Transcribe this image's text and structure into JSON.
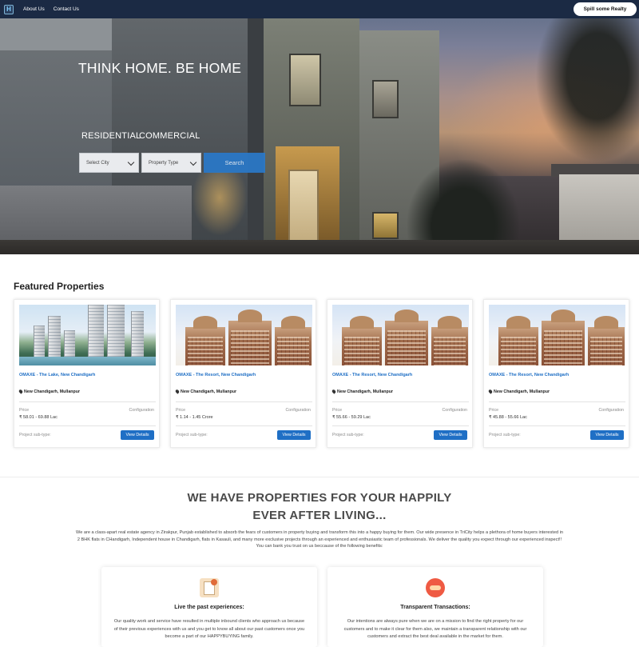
{
  "nav": {
    "logo": "H",
    "links": [
      "About Us",
      "Contact Us"
    ],
    "cta": "Spill some Realty"
  },
  "hero": {
    "title": "THINK HOME. BE HOME",
    "tabs": [
      "RESIDENTIAL",
      "COMMERCIAL"
    ],
    "select_city": "Select City",
    "property_type": "Property Type",
    "search_label": "Search"
  },
  "featured": {
    "title": "Featured Properties",
    "price_label": "Price",
    "config_label": "Configuration",
    "subtype_label": "Project sub-type:",
    "button_label": "View Details",
    "cards": [
      {
        "name": "OMAXE - The Lake, New Chandigarh",
        "location": "New Chandigarh, Mullanpur",
        "price": "₹ 58.01 - 69.88 Lac"
      },
      {
        "name": "OMAXE - The Resort, New Chandigarh",
        "location": "New Chandigarh, Mullanpur",
        "price": "₹ 1.14 - 1.45 Crore"
      },
      {
        "name": "OMAXE - The Resort, New Chandigarh",
        "location": "New Chandigarh, Mullanpur",
        "price": "₹ 55.66 - 59.29 Lac"
      },
      {
        "name": "OMAXE - The Resort, New Chandigarh",
        "location": "New Chandigarh, Mullanpur",
        "price": "₹ 45.88 - 55.66 Lac"
      }
    ]
  },
  "about": {
    "title_line1": "WE HAVE PROPERTIES FOR YOUR HAPPILY",
    "title_line2": "EVER AFTER LIVING...",
    "text": "We are a class-apart real estate agency in Zirakpur, Punjab established to absorb the fears of customers in property buying and transform this into a happy buying for them. Our wide presence in TriCity helps a plethora of home buyers interested in 2 BHK flats in CHandigarh, Independent house in Chandigarh, flats in Kasauli, and many more exclusive projects through an experienced and enthusiastic team of professionals. We deliver the quality you expect through our experienced inspect!! You can bank you trust on us beccause of the following benefits:",
    "benefits": [
      {
        "icon": "certificate-icon",
        "title": "Live the past experiences:",
        "text": "Our quality work and service have resulted in multiple inbound clients who approach us because of their previous experiences with us and you get to know all about our past customers once you become a part of our HAPPYBUYING family."
      },
      {
        "icon": "handshake-icon",
        "title": "Transparent Transactions:",
        "text": "Our intentions are always pure when we are on a mission to find the right property for our customers and to make it clear for them also, we maintain a transparent relationship with our customers and extract the best deal available in the market for them."
      }
    ]
  }
}
